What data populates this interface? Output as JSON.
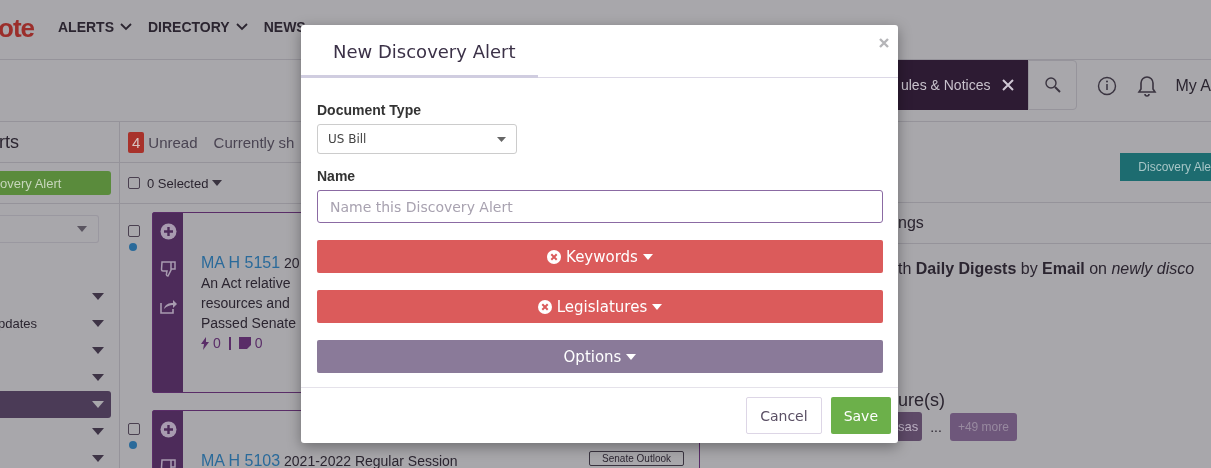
{
  "header": {
    "logo": "ote",
    "nav": [
      {
        "label": "ALERTS",
        "dropdown": true
      },
      {
        "label": "DIRECTORY",
        "dropdown": true
      },
      {
        "label": "NEWS",
        "dropdown": false
      }
    ]
  },
  "search": {
    "chip": "ules & Notices"
  },
  "user": {
    "label": "My A"
  },
  "sidebar": {
    "title": "rts",
    "button": "overy Alert",
    "items": [
      {
        "selected": false
      },
      {
        "label": "pdates",
        "selected": false
      },
      {
        "selected": false
      },
      {
        "selected": false
      },
      {
        "selected": true
      },
      {
        "selected": false
      },
      {
        "selected": false
      }
    ]
  },
  "feed": {
    "unread_count": "4",
    "unread_label": "Unread",
    "showing": "Currently sh",
    "selected_label": "0 Selected",
    "select_all_checked": false,
    "cards": [
      {
        "title": "MA H 5151",
        "session": "20",
        "lines": [
          "An Act relative",
          "resources and",
          "Passed Senate"
        ],
        "actions_count": "0",
        "notes_count": "0",
        "unread": true,
        "checked": false
      },
      {
        "title": "MA H 5103",
        "session": "2021-2022 Regular Session",
        "tag": "Senate Outlook",
        "unread": true,
        "checked": false
      }
    ]
  },
  "panel": {
    "button": "Discovery Ale",
    "heading": "ngs",
    "summary": "th **Daily Digests** by **Email** on *newly disco*",
    "legislatures_heading": "ure(s)",
    "chips": [
      {
        "label": "sas",
        "kind": "chip"
      },
      {
        "label": "...",
        "kind": "ellipsis"
      },
      {
        "label": "+49 more",
        "kind": "more"
      }
    ]
  },
  "modal": {
    "title": "New Discovery Alert",
    "document_type": {
      "label": "Document Type",
      "value": "US Bill"
    },
    "name": {
      "label": "Name",
      "placeholder": "Name this Discovery Alert"
    },
    "sections": [
      {
        "label": "Keywords",
        "kind": "required"
      },
      {
        "label": "Legislatures",
        "kind": "required"
      },
      {
        "label": "Options",
        "kind": "optional"
      }
    ],
    "buttons": [
      {
        "label": "Cancel",
        "kind": "secondary"
      },
      {
        "label": "Save",
        "kind": "primary"
      }
    ]
  }
}
